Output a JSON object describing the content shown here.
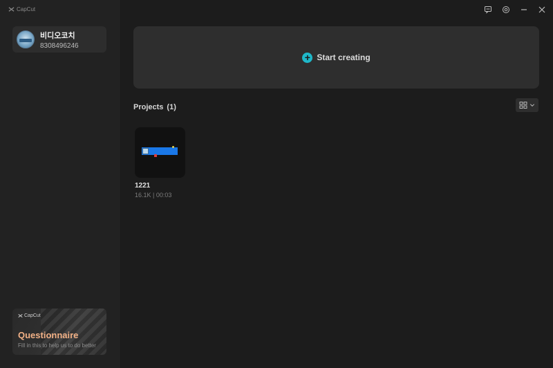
{
  "app": {
    "name": "CapCut"
  },
  "profile": {
    "name": "비디오코치",
    "id": "8308496246"
  },
  "promo": {
    "brand": "CapCut",
    "title": "Questionnaire",
    "subtitle": "Fill in this to help us to do better"
  },
  "main": {
    "start_label": "Start creating",
    "projects_label": "Projects",
    "projects_count": "(1)"
  },
  "projects": [
    {
      "name": "1221",
      "meta": "16.1K | 00:03"
    }
  ],
  "colors": {
    "accent": "#1fb8c9",
    "promo_title": "#f2b186",
    "thumb_bar": "#1a78e8"
  },
  "icons": {
    "window": [
      "feedback-icon",
      "settings-icon",
      "minimize-icon",
      "close-icon"
    ],
    "view": [
      "grid-view-icon",
      "chevron-down-icon"
    ]
  }
}
